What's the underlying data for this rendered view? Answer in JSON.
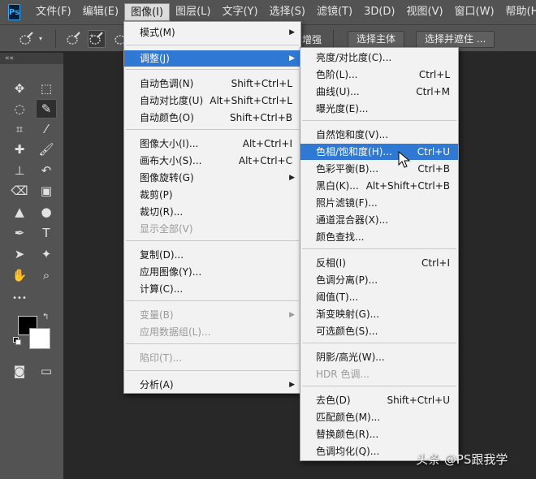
{
  "menubar": {
    "logo": "Ps",
    "items": [
      "文件(F)",
      "编辑(E)",
      "图像(I)",
      "图层(L)",
      "文字(Y)",
      "选择(S)",
      "滤镜(T)",
      "3D(D)",
      "视图(V)",
      "窗口(W)",
      "帮助(H)"
    ],
    "active_index": 2
  },
  "options_bar": {
    "enhance_label": "增强",
    "select_subject": "选择主体",
    "select_and_mask": "选择并遮住 ..."
  },
  "toolpanel": {
    "collapse_glyph": "««",
    "icons": [
      "move-icon",
      "marquee-icon",
      "lasso-icon",
      "quick-selection-icon",
      "crop-icon",
      "eyedropper-icon",
      "healing-brush-icon",
      "brush-icon",
      "clone-stamp-icon",
      "history-brush-icon",
      "eraser-icon",
      "gradient-icon",
      "blur-icon",
      "dodge-icon",
      "pen-icon",
      "type-icon",
      "path-selection-icon",
      "shape-icon",
      "hand-icon",
      "zoom-icon",
      "more-tools-icon",
      "quick-mask-icon",
      "screen-mode-icon"
    ],
    "foreground_color": "#000000",
    "background_color": "#ffffff"
  },
  "image_menu": {
    "items": [
      {
        "label": "模式(M)",
        "submenu": true
      },
      {
        "label": "调整(J)",
        "submenu": true,
        "highlighted": true
      },
      {
        "label": "自动色调(N)",
        "shortcut": "Shift+Ctrl+L"
      },
      {
        "label": "自动对比度(U)",
        "shortcut": "Alt+Shift+Ctrl+L"
      },
      {
        "label": "自动颜色(O)",
        "shortcut": "Shift+Ctrl+B"
      },
      {
        "label": "图像大小(I)...",
        "shortcut": "Alt+Ctrl+I"
      },
      {
        "label": "画布大小(S)...",
        "shortcut": "Alt+Ctrl+C"
      },
      {
        "label": "图像旋转(G)",
        "submenu": true
      },
      {
        "label": "裁剪(P)"
      },
      {
        "label": "裁切(R)..."
      },
      {
        "label": "显示全部(V)",
        "disabled": true
      },
      {
        "label": "复制(D)..."
      },
      {
        "label": "应用图像(Y)..."
      },
      {
        "label": "计算(C)..."
      },
      {
        "label": "变量(B)",
        "submenu": true,
        "disabled": true
      },
      {
        "label": "应用数据组(L)...",
        "disabled": true
      },
      {
        "label": "陷印(T)...",
        "disabled": true
      },
      {
        "label": "分析(A)",
        "submenu": true
      }
    ]
  },
  "adjust_menu": {
    "items": [
      {
        "label": "亮度/对比度(C)..."
      },
      {
        "label": "色阶(L)...",
        "shortcut": "Ctrl+L"
      },
      {
        "label": "曲线(U)...",
        "shortcut": "Ctrl+M"
      },
      {
        "label": "曝光度(E)..."
      },
      {
        "label": "自然饱和度(V)..."
      },
      {
        "label": "色相/饱和度(H)...",
        "shortcut": "Ctrl+U",
        "highlighted": true
      },
      {
        "label": "色彩平衡(B)...",
        "shortcut": "Ctrl+B"
      },
      {
        "label": "黑白(K)...",
        "shortcut": "Alt+Shift+Ctrl+B"
      },
      {
        "label": "照片滤镜(F)..."
      },
      {
        "label": "通道混合器(X)..."
      },
      {
        "label": "颜色查找..."
      },
      {
        "label": "反相(I)",
        "shortcut": "Ctrl+I"
      },
      {
        "label": "色调分离(P)..."
      },
      {
        "label": "阈值(T)..."
      },
      {
        "label": "渐变映射(G)..."
      },
      {
        "label": "可选颜色(S)..."
      },
      {
        "label": "阴影/高光(W)..."
      },
      {
        "label": "HDR 色调...",
        "disabled": true
      },
      {
        "label": "去色(D)",
        "shortcut": "Shift+Ctrl+U"
      },
      {
        "label": "匹配颜色(M)..."
      },
      {
        "label": "替换颜色(R)..."
      },
      {
        "label": "色调均化(Q)..."
      }
    ]
  },
  "watermark": "头条 @PS跟我学",
  "colors": {
    "highlight": "#2f78d4",
    "menu_bg": "#f2f2f2",
    "app_bg": "#535353",
    "canvas_bg": "#282828"
  }
}
